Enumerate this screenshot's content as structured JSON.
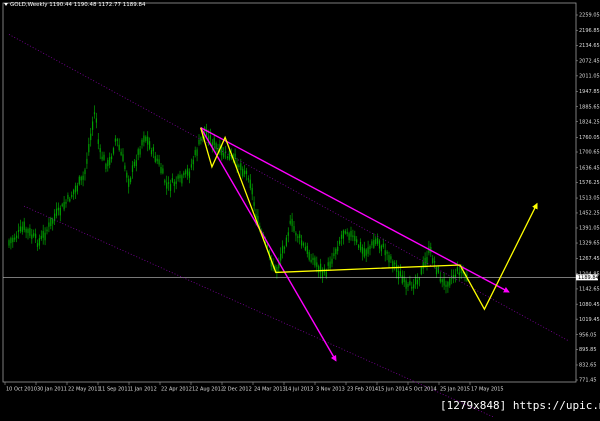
{
  "header": {
    "symbol_title": "GOLD,Weekly",
    "ohlc": "1190.44 1190.48 1172.77 1189.84"
  },
  "current_price_label": "1189.84",
  "watermark": "[1279x848] https://upic.me/",
  "colors": {
    "background": "#000000",
    "candles": "#00a000",
    "main_trendline": "#ff00ff",
    "channel_dots": "#8000a0",
    "wave_pattern": "#ffff00",
    "price_line": "#c0c0c0"
  },
  "chart_data": {
    "type": "candlestick",
    "title": "GOLD,Weekly",
    "y_ticks": [
      "2259.05",
      "2196.85",
      "2134.65",
      "2072.45",
      "2011.05",
      "1947.85",
      "1885.65",
      "1824.25",
      "1760.05",
      "1700.65",
      "1636.45",
      "1576.25",
      "1513.05",
      "1452.25",
      "1391.05",
      "1329.65",
      "1267.45",
      "1204.85",
      "1142.65",
      "1080.45",
      "1019.45",
      "956.05",
      "895.85",
      "832.65",
      "771.45"
    ],
    "x_ticks": [
      "10 Oct 2010",
      "30 Jan 2011",
      "22 May 2011",
      "11 Sep 2011",
      "1 Jan 2012",
      "22 Apr 2012",
      "12 Aug 2012",
      "2 Dec 2012",
      "24 Mar 2013",
      "14 Jul 2013",
      "3 Nov 2013",
      "23 Feb 2014",
      "15 Jun 2014",
      "5 Oct 2014",
      "25 Jan 2015",
      "17 May 2015"
    ],
    "ylim": [
      771.45,
      2259.05
    ],
    "current_price": 1189.84,
    "price_path": [
      {
        "date": "2010-10-10",
        "price": 1330
      },
      {
        "date": "2010-12-05",
        "price": 1390
      },
      {
        "date": "2011-01-30",
        "price": 1330
      },
      {
        "date": "2011-03-27",
        "price": 1430
      },
      {
        "date": "2011-05-22",
        "price": 1510
      },
      {
        "date": "2011-07-17",
        "price": 1600
      },
      {
        "date": "2011-08-28",
        "price": 1880
      },
      {
        "date": "2011-09-11",
        "price": 1700
      },
      {
        "date": "2011-10-16",
        "price": 1640
      },
      {
        "date": "2011-11-13",
        "price": 1760
      },
      {
        "date": "2012-01-01",
        "price": 1580
      },
      {
        "date": "2012-02-26",
        "price": 1770
      },
      {
        "date": "2012-04-22",
        "price": 1650
      },
      {
        "date": "2012-05-20",
        "price": 1560
      },
      {
        "date": "2012-07-15",
        "price": 1590
      },
      {
        "date": "2012-08-12",
        "price": 1620
      },
      {
        "date": "2012-10-07",
        "price": 1790
      },
      {
        "date": "2012-12-02",
        "price": 1700
      },
      {
        "date": "2013-01-27",
        "price": 1670
      },
      {
        "date": "2013-03-24",
        "price": 1600
      },
      {
        "date": "2013-04-21",
        "price": 1420
      },
      {
        "date": "2013-06-30",
        "price": 1210
      },
      {
        "date": "2013-08-25",
        "price": 1410
      },
      {
        "date": "2013-10-20",
        "price": 1300
      },
      {
        "date": "2013-12-29",
        "price": 1200
      },
      {
        "date": "2014-03-16",
        "price": 1390
      },
      {
        "date": "2014-05-25",
        "price": 1290
      },
      {
        "date": "2014-07-13",
        "price": 1340
      },
      {
        "date": "2014-09-07",
        "price": 1260
      },
      {
        "date": "2014-11-02",
        "price": 1140
      },
      {
        "date": "2014-12-21",
        "price": 1200
      },
      {
        "date": "2015-01-25",
        "price": 1300
      },
      {
        "date": "2015-03-15",
        "price": 1160
      },
      {
        "date": "2015-05-17",
        "price": 1220
      },
      {
        "date": "2015-06-14",
        "price": 1190
      }
    ],
    "overlays": {
      "downtrend_line": [
        {
          "date": "2012-09-23",
          "price": 1800
        },
        {
          "date": "2015-11-15",
          "price": 1130
        }
      ],
      "steep_line": [
        {
          "date": "2012-09-23",
          "price": 1800
        },
        {
          "date": "2014-02-09",
          "price": 850
        }
      ],
      "lower_channel": [
        {
          "date": "2010-12-05",
          "price": 1480
        },
        {
          "date": "2016-04-10",
          "price": 520
        }
      ],
      "upper_channel": [
        {
          "date": "2010-10-10",
          "price": 2180
        },
        {
          "date": "2016-06-26",
          "price": 930
        }
      ],
      "yellow_wave": [
        {
          "date": "2012-09-23",
          "price": 1800
        },
        {
          "date": "2012-11-04",
          "price": 1640
        },
        {
          "date": "2012-12-23",
          "price": 1760
        },
        {
          "date": "2013-06-30",
          "price": 1210
        },
        {
          "date": "2015-05-17",
          "price": 1240
        },
        {
          "date": "2015-08-16",
          "price": 1060
        },
        {
          "date": "2016-02-28",
          "price": 1490
        }
      ]
    }
  }
}
